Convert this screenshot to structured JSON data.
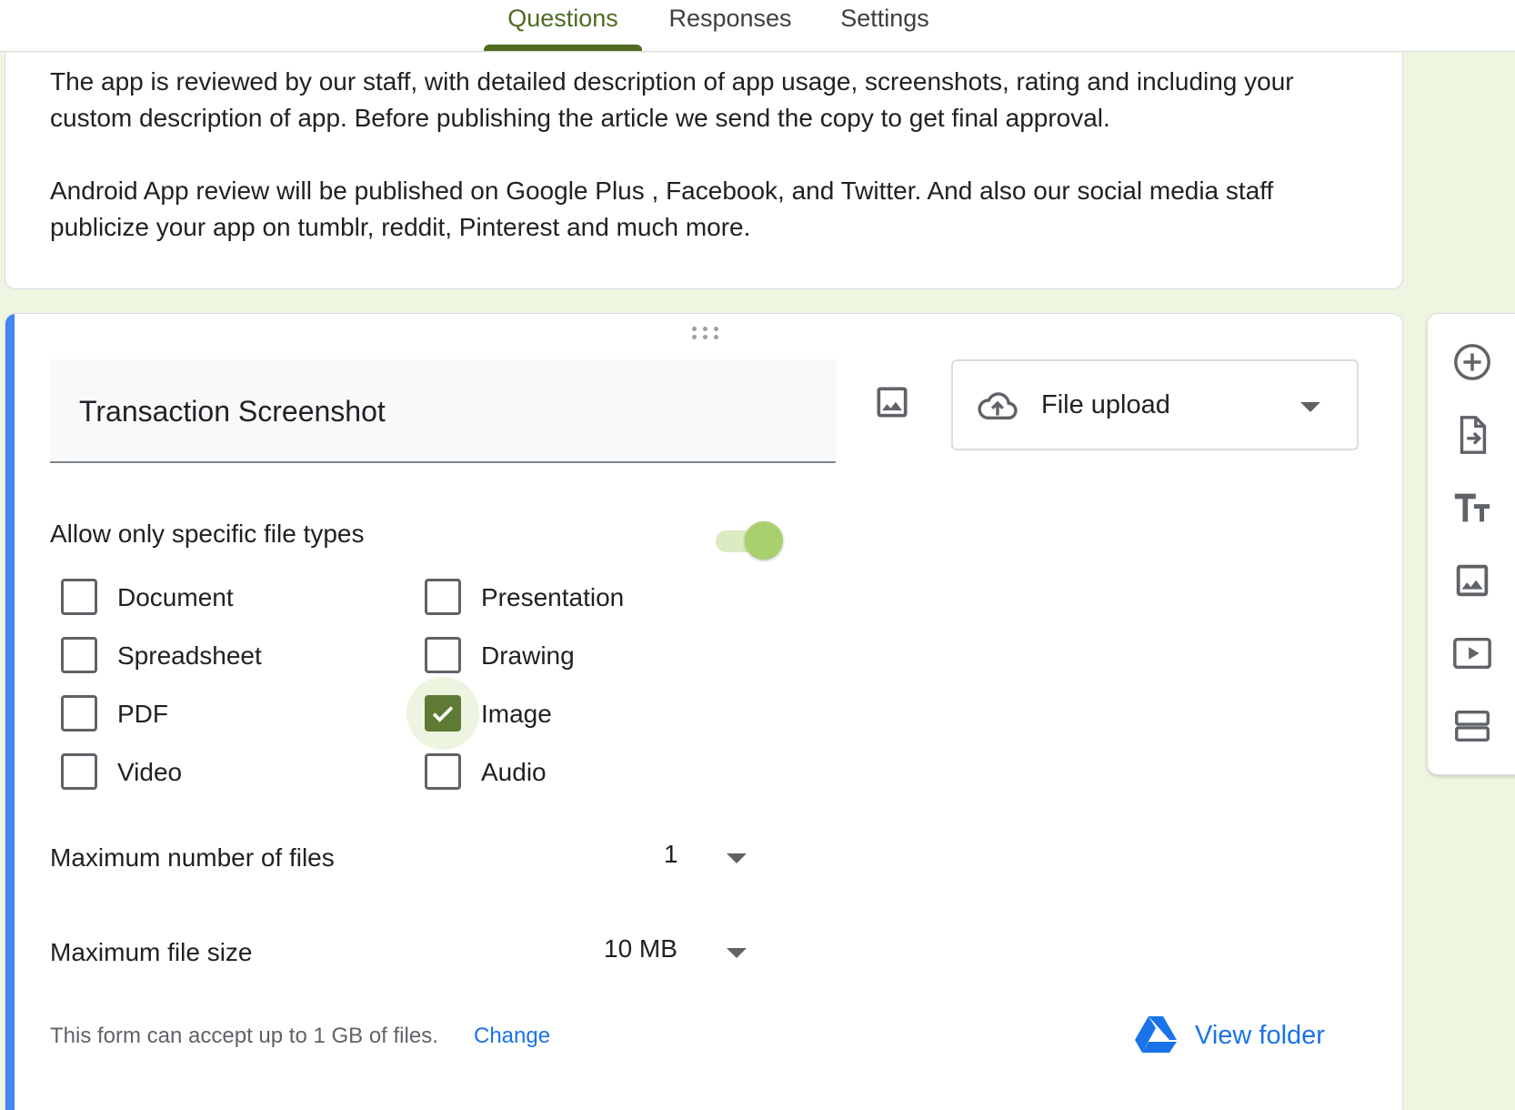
{
  "tabs": [
    {
      "label": "Questions",
      "active": true
    },
    {
      "label": "Responses",
      "active": false
    },
    {
      "label": "Settings",
      "active": false
    }
  ],
  "description": {
    "paragraphs": [
      "The app is reviewed by our staff, with detailed description of app usage, screenshots, rating and including your custom description of app. Before publishing the article we send the copy to get final approval.",
      "Android App review will be published on Google Plus , Facebook, and Twitter. And also our social media staff publicize your app on tumblr, reddit, Pinterest and much more."
    ]
  },
  "question": {
    "title": "Transaction Screenshot",
    "type_select": {
      "label": "File upload",
      "icon": "cloud-upload-icon"
    },
    "allow_specific_types": {
      "label": "Allow only specific file types",
      "enabled": true
    },
    "file_types": [
      {
        "label": "Document",
        "checked": false
      },
      {
        "label": "Presentation",
        "checked": false
      },
      {
        "label": "Spreadsheet",
        "checked": false
      },
      {
        "label": "Drawing",
        "checked": false
      },
      {
        "label": "PDF",
        "checked": false
      },
      {
        "label": "Image",
        "checked": true
      },
      {
        "label": "Video",
        "checked": false
      },
      {
        "label": "Audio",
        "checked": false
      }
    ],
    "max_files": {
      "label": "Maximum number of files",
      "value": "1"
    },
    "max_size": {
      "label": "Maximum file size",
      "value": "10 MB"
    },
    "footer": {
      "note": "This form can accept up to 1 GB of files.",
      "change_link": "Change",
      "view_folder": "View folder"
    }
  },
  "toolbar": {
    "icons": [
      "add-question-icon",
      "import-questions-icon",
      "add-title-icon",
      "add-image-icon",
      "add-video-icon",
      "add-section-icon"
    ]
  },
  "colors": {
    "accent": "#4e6b22",
    "card_accent": "#4285f4",
    "background": "#eef5e1",
    "link": "#1a73e8",
    "checkbox_checked": "#5f7a34",
    "toggle_thumb": "#a8d06c"
  }
}
